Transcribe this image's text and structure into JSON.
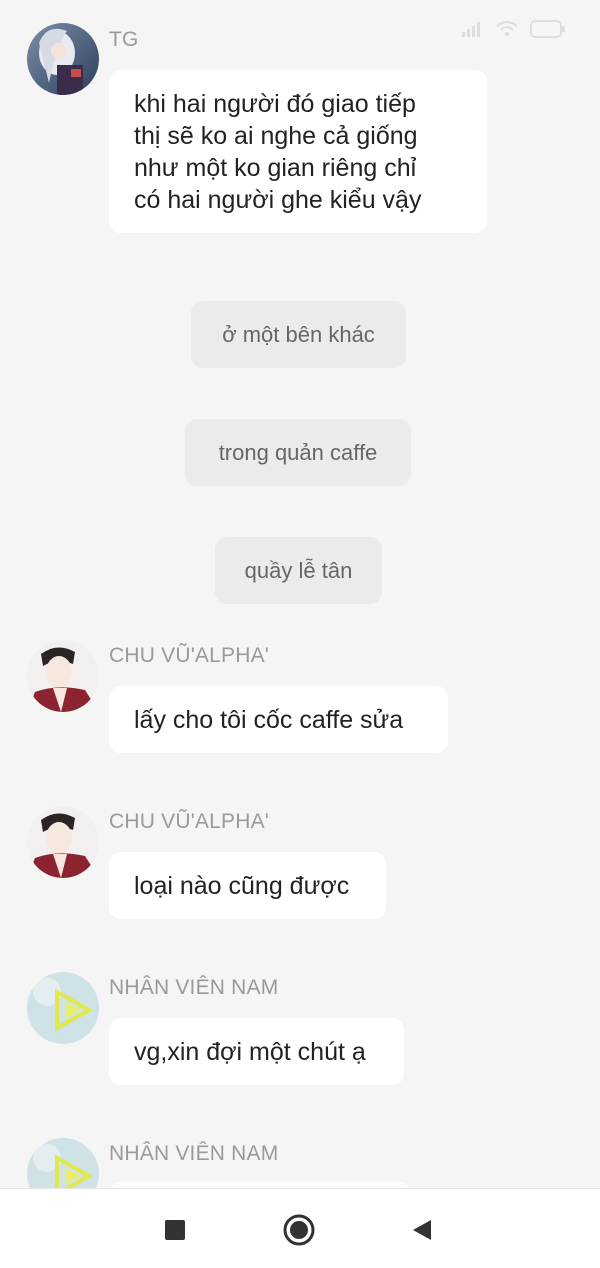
{
  "status_bar": {
    "time": "",
    "icons": [
      "signal-icon",
      "wifi-icon",
      "battery-icon"
    ]
  },
  "messages": [
    {
      "sender": "TG",
      "avatar": "tg-avatar",
      "text_lines": [
        "khi hai người đó giao tiếp",
        "thị sẽ ko ai nghe cả giống",
        "như một ko gian riêng chỉ",
        "có hai người ghe kiểu vậy"
      ]
    },
    {
      "narration": "ở một bên khác"
    },
    {
      "narration": "trong quản caffe"
    },
    {
      "narration": "quầy lễ tân"
    },
    {
      "sender": "CHU VŨ'ALPHA'",
      "avatar": "chu-vu-avatar",
      "text": "lấy cho tôi cốc caffe sửa"
    },
    {
      "sender": "CHU VŨ'ALPHA'",
      "avatar": "chu-vu-avatar",
      "text": "loại nào cũng được"
    },
    {
      "sender": "NHÂN VIÊN NAM",
      "avatar": "nhan-vien-avatar",
      "text": "vg,xin đợi một chút ạ"
    },
    {
      "sender": "NHÂN VIÊN NAM",
      "avatar": "nhan-vien-avatar",
      "text": ""
    }
  ],
  "nav_bar": {
    "buttons": [
      "recent-apps-button",
      "home-button",
      "back-button"
    ]
  },
  "colors": {
    "background": "#f5f5f5",
    "bubble": "#ffffff",
    "narration_bg": "#ebebeb",
    "sender_text": "#9a9a9a"
  }
}
